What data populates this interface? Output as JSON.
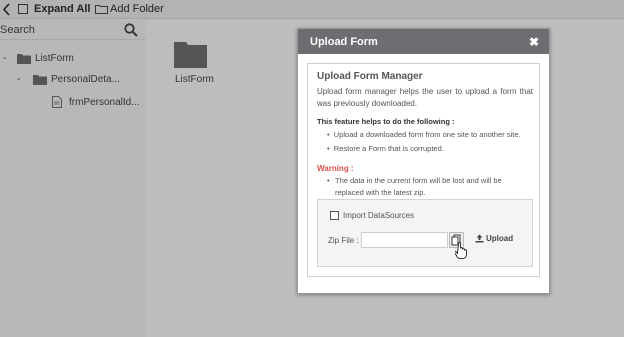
{
  "toolbar": {
    "expand_all_label": "Expand All",
    "add_folder_label": "Add Folder"
  },
  "sidebar": {
    "search_label": "Search",
    "tree": [
      {
        "label": "ListForm",
        "toggle": "-"
      },
      {
        "label": "PersonalDeta...",
        "toggle": "-"
      },
      {
        "label": "frmPersonalId..."
      }
    ]
  },
  "main": {
    "folder_label": "ListForm"
  },
  "modal": {
    "title": "Upload Form",
    "close_glyph": "✖",
    "heading": "Upload Form Manager",
    "description": "Upload form manager helps the user to upload a form that was previously downloaded.",
    "feature_heading": "This feature helps to do the following  :",
    "features": [
      "Upload a downloaded form from one site to another site.",
      "Restore a Form that is corrupted."
    ],
    "warning_heading": "Warning  :",
    "warning_text": "The data in the current form will be lost and will be replaced with the latest zip.",
    "import_label": "Import DataSources",
    "zip_label": "Zip File :",
    "upload_label": "Upload"
  },
  "colors": {
    "header": "#6d6e71",
    "warning": "#d9534f",
    "background": "#bdbdbd"
  }
}
